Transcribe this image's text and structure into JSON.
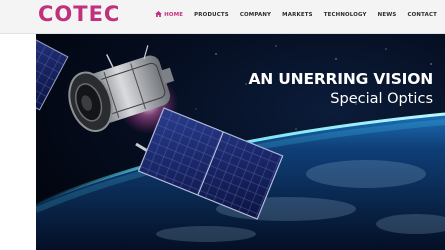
{
  "logo": {
    "text": "COTEC",
    "mark": "®"
  },
  "nav": {
    "items": [
      {
        "label": "HOME",
        "active": true,
        "icon": "home-icon"
      },
      {
        "label": "PRODUCTS",
        "active": false
      },
      {
        "label": "COMPANY",
        "active": false
      },
      {
        "label": "MARKETS",
        "active": false
      },
      {
        "label": "TECHNOLOGY",
        "active": false
      },
      {
        "label": "NEWS",
        "active": false
      },
      {
        "label": "CONTACT",
        "active": false
      }
    ]
  },
  "hero": {
    "headline": "AN UNERRING VISION",
    "subline": "Special Optics",
    "image": "satellite-in-orbit"
  },
  "colors": {
    "brand": "#c1307c",
    "header_bg": "#f4f4f4",
    "space": "#020814",
    "earth_glow": "#38c8ff"
  }
}
